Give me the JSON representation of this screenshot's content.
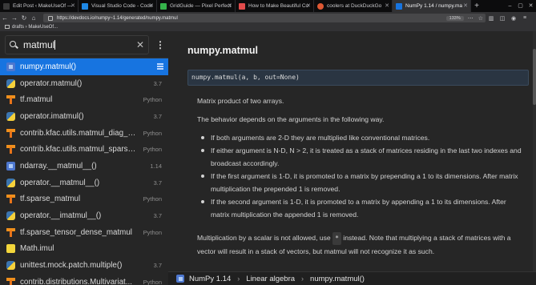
{
  "browser": {
    "tabs": [
      {
        "title": "Edit Post ‹ MakeUseOf —",
        "color": "#3a3a3a"
      },
      {
        "title": "Visual Studio Code - Code",
        "color": "#1e88e5"
      },
      {
        "title": "GridGuide — Pixel Perfect",
        "color": "#35b34a"
      },
      {
        "title": "How to Make Beautiful Co",
        "color": "#e24b4b"
      },
      {
        "title": "coolers at DuckDuckGo",
        "color": "#de5833"
      },
      {
        "title": "NumPy 1.14 / numpy.ma",
        "color": "#1774e0"
      }
    ],
    "new_tab": "+",
    "url": "https://devdocs.io/numpy~1.14/generated/numpy.matmul",
    "zoom": "133%",
    "bookmark": "drafts › MakeUseOf..."
  },
  "sidebar": {
    "query": "matmul",
    "results": [
      {
        "label": "numpy.matmul()",
        "version": "",
        "icon": "numpy",
        "selected": true
      },
      {
        "label": "operator.matmul()",
        "version": "3.7",
        "icon": "python"
      },
      {
        "label": "tf.matmul",
        "version": "Python",
        "icon": "tensorflow"
      },
      {
        "label": "operator.imatmul()",
        "version": "3.7",
        "icon": "python"
      },
      {
        "label": "contrib.kfac.utils.matmul_diag_s...",
        "version": "Python",
        "icon": "tensorflow"
      },
      {
        "label": "contrib.kfac.utils.matmul_sparse...",
        "version": "Python",
        "icon": "tensorflow"
      },
      {
        "label": "ndarray.__matmul__()",
        "version": "1.14",
        "icon": "numpy"
      },
      {
        "label": "operator.__matmul__()",
        "version": "3.7",
        "icon": "python"
      },
      {
        "label": "tf.sparse_matmul",
        "version": "Python",
        "icon": "tensorflow"
      },
      {
        "label": "operator.__imatmul__()",
        "version": "3.7",
        "icon": "python"
      },
      {
        "label": "tf.sparse_tensor_dense_matmul",
        "version": "Python",
        "icon": "tensorflow"
      },
      {
        "label": "Math.imul",
        "version": "",
        "icon": "javascript"
      },
      {
        "label": "unittest.mock.patch.multiple()",
        "version": "3.7",
        "icon": "python"
      },
      {
        "label": "contrib.distributions.Multivariat...",
        "version": "Python",
        "icon": "tensorflow"
      }
    ]
  },
  "doc": {
    "title": "numpy.matmul",
    "signature": "numpy.matmul(a, b, out=None)",
    "summary": "Matrix product of two arrays.",
    "behavior_intro": "The behavior depends on the arguments in the following way.",
    "bullets": [
      "If both arguments are 2-D they are multiplied like conventional matrices.",
      "If either argument is N-D, N > 2, it is treated as a stack of matrices residing in the last two indexes and broadcast accordingly.",
      "If the first argument is 1-D, it is promoted to a matrix by prepending a 1 to its dimensions. After matrix multiplication the prepended 1 is removed.",
      "If the second argument is 1-D, it is promoted to a matrix by appending a 1 to its dimensions. After matrix multiplication the appended 1 is removed."
    ],
    "scalar_note_before": "Multiplication by a scalar is not allowed, use ",
    "scalar_note_code": "*",
    "scalar_note_after": " instead. Note that multiplying a stack of matrices with a vector will result in a stack of vectors, but matmul will not recognize it as such."
  },
  "breadcrumb": {
    "items": [
      "NumPy 1.14",
      "Linear algebra",
      "numpy.matmul()"
    ],
    "separator": "›"
  }
}
